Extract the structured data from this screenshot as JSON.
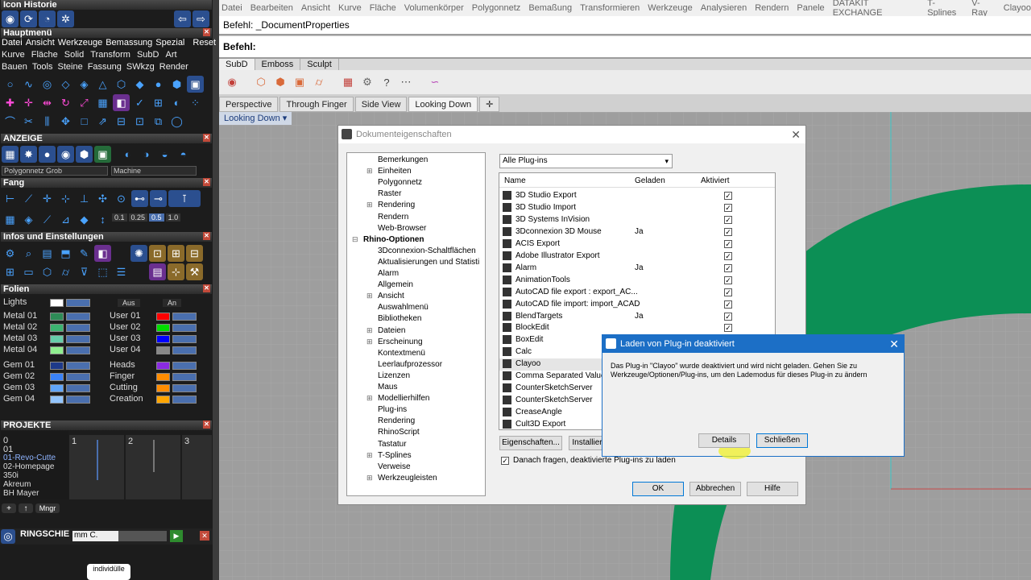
{
  "left": {
    "history_title": "Icon Historie",
    "mainmenu_title": "Hauptmenü",
    "menu_row": [
      "Datei",
      "Ansicht",
      "Werkzeuge",
      "Bemassung",
      "Spezial",
      "Reset"
    ],
    "menu_row2": [
      "Kurve",
      "Fläche",
      "Solid",
      "Transform",
      "SubD",
      "Art"
    ],
    "menu_row3": [
      "Bauen",
      "Tools",
      "Steine",
      "Fassung",
      "SWkzg",
      "Render"
    ],
    "anzeige_title": "ANZEIGE",
    "anzeige_select1": "Polygonnetz Grob",
    "anzeige_select2": "Machine",
    "fang_title": "Fang",
    "fang_values": [
      "0.1",
      "0.25",
      "0.5",
      "1.0"
    ],
    "infos_title": "Infos und Einstellungen",
    "folien_title": "Folien",
    "folien_toggles": [
      "Aus",
      "An"
    ],
    "layers_left": [
      "Lights",
      "Metal 01",
      "Metal 02",
      "Metal 03",
      "Metal 04",
      "Gem 01",
      "Gem 02",
      "Gem 03",
      "Gem 04"
    ],
    "layers_right": [
      "User 01",
      "User 02",
      "User 03",
      "User 04",
      "Heads",
      "Finger",
      "Cutting",
      "Creation"
    ],
    "layer_colors_left": [
      "#ffffff",
      "#2e8b57",
      "#3cb371",
      "#66cdaa",
      "#90ee90",
      "#1e3a8a",
      "#3b82f6",
      "#60a5fa",
      "#93c5fd"
    ],
    "layer_colors_right": [
      "#ff0000",
      "#00dd00",
      "#0000ff",
      "#888888",
      "#8a2be2",
      "#ff8c00",
      "#ff8c00",
      "#ffa500"
    ],
    "projekte_title": "PROJEKTE",
    "projects": [
      "0",
      "01",
      "01-Revo-Cutte",
      "02-Homepage",
      "350i",
      "Akreum",
      "BH Mayer"
    ],
    "thumb_labels": [
      "1",
      "2",
      "3"
    ],
    "proj_btn": "Mngr",
    "ring_title": "RINGSCHIE",
    "ring_input": "mm C.",
    "logo_text": "individülle"
  },
  "main": {
    "menubar": [
      "Datei",
      "Bearbeiten",
      "Ansicht",
      "Kurve",
      "Fläche",
      "Volumenkörper",
      "Polygonnetz",
      "Bemaßung",
      "Transformieren",
      "Werkzeuge",
      "Analysieren",
      "Rendern",
      "Panele",
      "DATAKIT EXCHANGE",
      "T-Splines",
      "V-Ray",
      "Clayoo"
    ],
    "cmd_history": "Befehl: _DocumentProperties",
    "cmd_prompt": "Befehl:",
    "tool_tabs": [
      "SubD",
      "Emboss",
      "Sculpt"
    ],
    "view_tabs": [
      "Perspective",
      "Through Finger",
      "Side View",
      "Looking Down"
    ],
    "viewport_label": "Looking Down",
    "dialog": {
      "title": "Dokumenteigenschaften",
      "tree": [
        {
          "t": "Bemerkungen",
          "lvl": 1,
          "exp": false
        },
        {
          "t": "Einheiten",
          "lvl": 1,
          "exp": true
        },
        {
          "t": "Polygonnetz",
          "lvl": 1,
          "exp": false
        },
        {
          "t": "Raster",
          "lvl": 1,
          "exp": false
        },
        {
          "t": "Rendering",
          "lvl": 1,
          "exp": true
        },
        {
          "t": "Rendern",
          "lvl": 1,
          "exp": false
        },
        {
          "t": "Web-Browser",
          "lvl": 1,
          "exp": false
        },
        {
          "t": "Rhino-Optionen",
          "lvl": 0,
          "exp": true
        },
        {
          "t": "3Dconnexion-Schaltflächen",
          "lvl": 1,
          "exp": false
        },
        {
          "t": "Aktualisierungen und Statisti",
          "lvl": 1,
          "exp": false
        },
        {
          "t": "Alarm",
          "lvl": 1,
          "exp": false
        },
        {
          "t": "Allgemein",
          "lvl": 1,
          "exp": false
        },
        {
          "t": "Ansicht",
          "lvl": 1,
          "exp": true
        },
        {
          "t": "Auswahlmenü",
          "lvl": 1,
          "exp": false
        },
        {
          "t": "Bibliotheken",
          "lvl": 1,
          "exp": false
        },
        {
          "t": "Dateien",
          "lvl": 1,
          "exp": true
        },
        {
          "t": "Erscheinung",
          "lvl": 1,
          "exp": true
        },
        {
          "t": "Kontextmenü",
          "lvl": 1,
          "exp": false
        },
        {
          "t": "Leerlaufprozessor",
          "lvl": 1,
          "exp": false
        },
        {
          "t": "Lizenzen",
          "lvl": 1,
          "exp": false
        },
        {
          "t": "Maus",
          "lvl": 1,
          "exp": false
        },
        {
          "t": "Modellierhilfen",
          "lvl": 1,
          "exp": true
        },
        {
          "t": "Plug-ins",
          "lvl": 1,
          "exp": false
        },
        {
          "t": "Rendering",
          "lvl": 1,
          "exp": false
        },
        {
          "t": "RhinoScript",
          "lvl": 1,
          "exp": false
        },
        {
          "t": "Tastatur",
          "lvl": 1,
          "exp": false
        },
        {
          "t": "T-Splines",
          "lvl": 1,
          "exp": true
        },
        {
          "t": "Verweise",
          "lvl": 1,
          "exp": false
        },
        {
          "t": "Werkzeugleisten",
          "lvl": 1,
          "exp": true
        }
      ],
      "filter": "Alle Plug-ins",
      "columns": [
        "Name",
        "Geladen",
        "Aktiviert"
      ],
      "plugins": [
        {
          "n": "3D Studio Export",
          "g": ""
        },
        {
          "n": "3D Studio Import",
          "g": ""
        },
        {
          "n": "3D Systems InVision",
          "g": ""
        },
        {
          "n": "3Dconnexion 3D Mouse",
          "g": "Ja"
        },
        {
          "n": "ACIS Export",
          "g": ""
        },
        {
          "n": "Adobe Illustrator Export",
          "g": ""
        },
        {
          "n": "Alarm",
          "g": "Ja"
        },
        {
          "n": "AnimationTools",
          "g": ""
        },
        {
          "n": "AutoCAD file export : export_AC...",
          "g": ""
        },
        {
          "n": "AutoCAD file import: import_ACAD",
          "g": ""
        },
        {
          "n": "BlendTargets",
          "g": "Ja"
        },
        {
          "n": "BlockEdit",
          "g": ""
        },
        {
          "n": "BoxEdit",
          "g": ""
        },
        {
          "n": "Calc",
          "g": ""
        },
        {
          "n": "Clayoo",
          "g": ""
        },
        {
          "n": "Comma Separated Value I",
          "g": ""
        },
        {
          "n": "CounterSketchServer",
          "g": ""
        },
        {
          "n": "CounterSketchServer",
          "g": ""
        },
        {
          "n": "CreaseAngle",
          "g": ""
        },
        {
          "n": "Cult3D Export",
          "g": ""
        }
      ],
      "btn_props": "Eigenschaften...",
      "btn_install": "Installier",
      "ask_label": "Danach fragen, deaktivierte Plug-ins zu laden",
      "ok": "OK",
      "cancel": "Abbrechen",
      "help": "Hilfe"
    },
    "modal": {
      "title": "Laden von Plug-in deaktiviert",
      "message": "Das Plug-in \"Clayoo\" wurde deaktiviert und wird nicht geladen. Gehen Sie zu Werkzeuge/Optionen/Plug-ins, um den Lademodus für dieses Plug-in zu ändern",
      "details": "Details",
      "close": "Schließen"
    }
  }
}
